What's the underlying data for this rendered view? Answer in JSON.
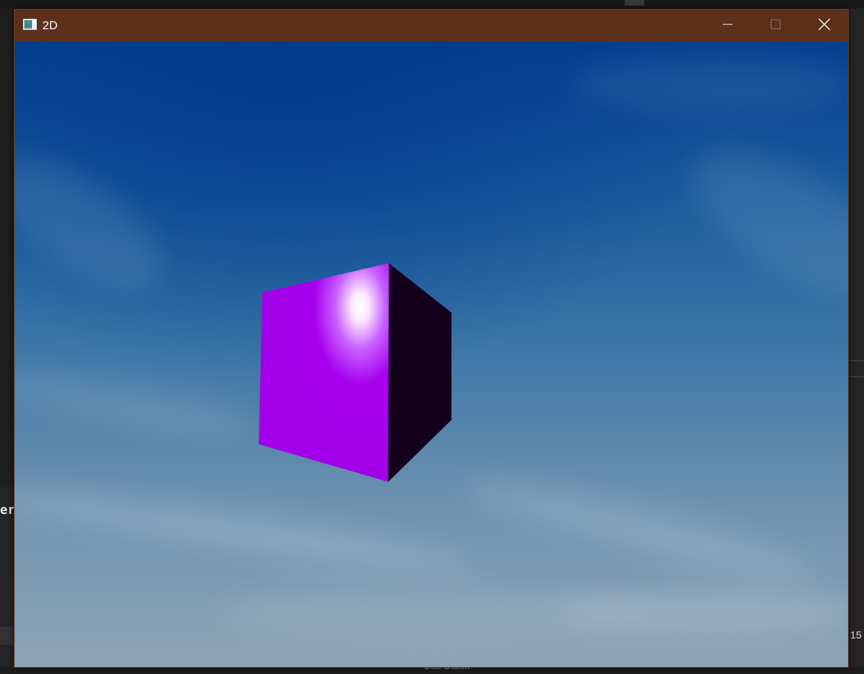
{
  "window": {
    "title": "2D",
    "app_icon": "window-app-icon",
    "controls": {
      "minimize_icon": "minimize-icon",
      "maximize_icon": "maximize-icon",
      "close_icon": "close-icon"
    },
    "titlebar_color": "#5c301b"
  },
  "scene": {
    "background": "sky",
    "object": "cube",
    "cube_front_color": "#a600ee",
    "cube_side_color": "#14001c",
    "sky_top_color": "#063f8f",
    "sky_bottom_color": "#8da4b5"
  },
  "background_ide": {
    "left_text": "er",
    "right_number": "15",
    "bottom_text": "Call Stack"
  }
}
